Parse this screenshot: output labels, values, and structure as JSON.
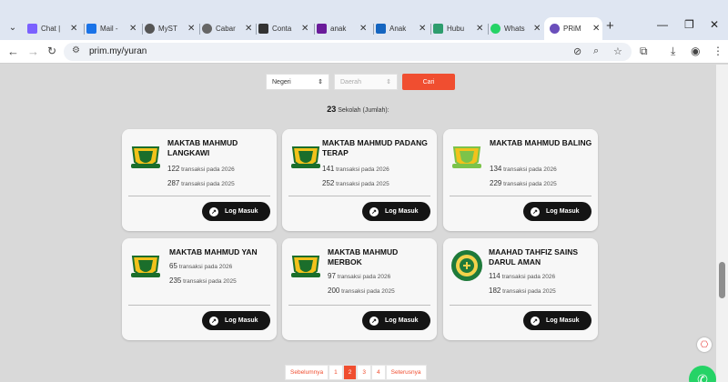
{
  "browser": {
    "tabs": [
      {
        "title": "Chat |",
        "color": "#7b61ff"
      },
      {
        "title": "Mail -",
        "color": "#1a73e8"
      },
      {
        "title": "MyST",
        "color": "#555555"
      },
      {
        "title": "Cabar",
        "color": "#666666"
      },
      {
        "title": "Conta",
        "color": "#333333"
      },
      {
        "title": "anak",
        "color": "#6a1b9a"
      },
      {
        "title": "Anak",
        "color": "#1565c0"
      },
      {
        "title": "Hubu",
        "color": "#2e9d6e"
      },
      {
        "title": "Whats",
        "color": "#25d366"
      },
      {
        "title": "PRiM",
        "color": "#6b4fbb"
      }
    ],
    "url": "prim.my/yuran"
  },
  "filters": {
    "state": "Negeri",
    "district": "Daerah",
    "search_button": "Cari"
  },
  "result": {
    "count": "23",
    "label": "Sekolah (Jumlah):"
  },
  "schools": [
    {
      "name": "MAKTAB MAHMUD LANGKAWI",
      "n2026": "122",
      "n2025": "287"
    },
    {
      "name": "MAKTAB MAHMUD PADANG TERAP",
      "n2026": "141",
      "n2025": "252"
    },
    {
      "name": "MAKTAB MAHMUD BALING",
      "n2026": "134",
      "n2025": "229"
    },
    {
      "name": "MAKTAB MAHMUD YAN",
      "n2026": "65",
      "n2025": "235"
    },
    {
      "name": "MAKTAB MAHMUD MERBOK",
      "n2026": "97",
      "n2025": "200"
    },
    {
      "name": "MAAHAD TAHFIZ SAINS DARUL AMAN",
      "n2026": "114",
      "n2025": "182"
    }
  ],
  "card_text": {
    "trans_2026": "transaksi pada 2026",
    "trans_2025": "transaksi pada 2025",
    "login": "Log Masuk"
  },
  "pagination": {
    "prev": "Sebelumnya",
    "pages": [
      "1",
      "2",
      "3",
      "4"
    ],
    "current": "2",
    "next": "Seterusnya"
  }
}
